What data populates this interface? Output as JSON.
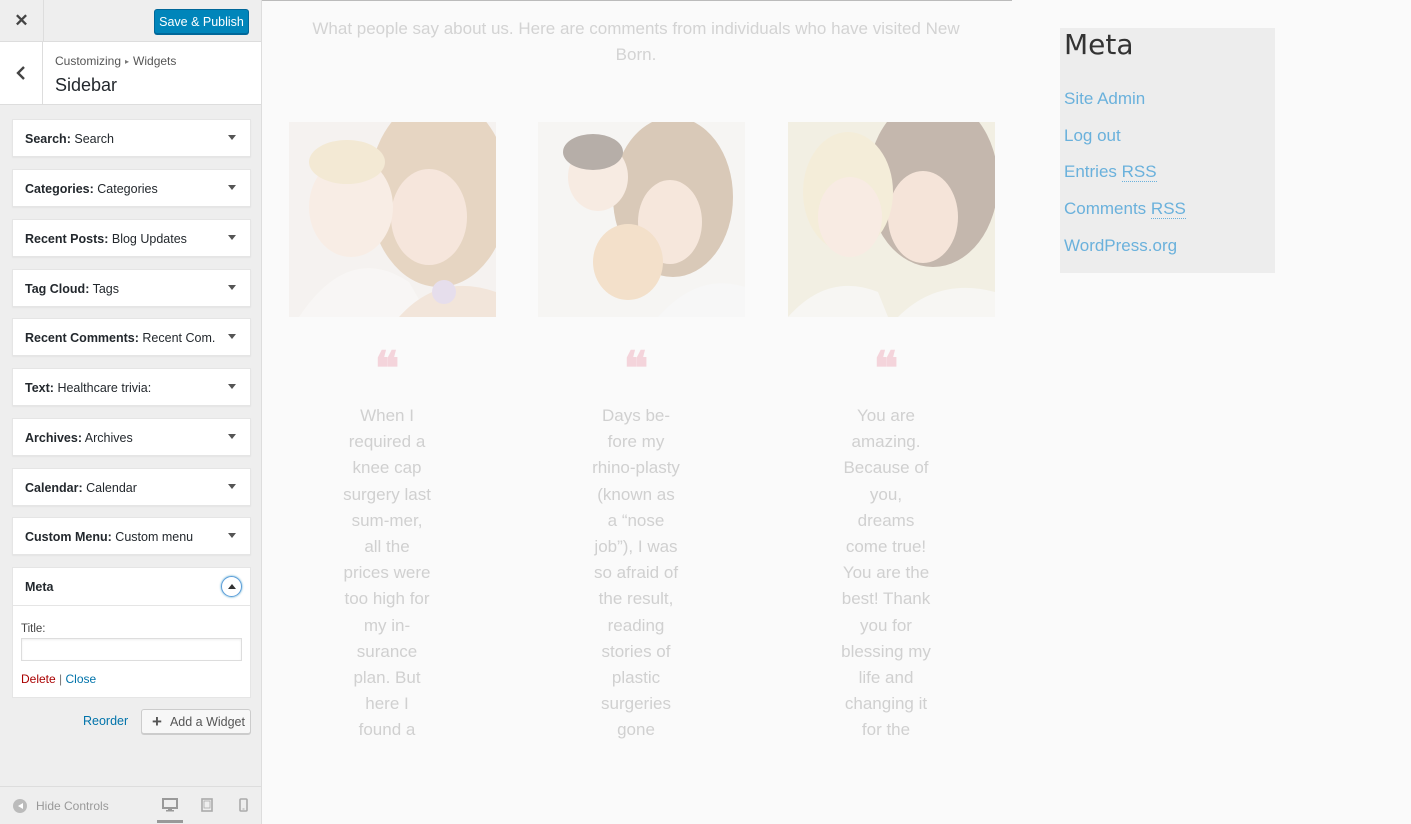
{
  "toolbar": {
    "close_icon": "close-icon",
    "publish_label": "Save & Publish"
  },
  "section": {
    "crumb_parent": "Customizing",
    "crumb_separator": "▸",
    "crumb_child": "Widgets",
    "title": "Sidebar"
  },
  "widgets": [
    {
      "type": "Search",
      "title": "Search"
    },
    {
      "type": "Categories",
      "title": "Categories"
    },
    {
      "type": "Recent Posts",
      "title": "Blog Updates"
    },
    {
      "type": "Tag Cloud",
      "title": "Tags"
    },
    {
      "type": "Recent Comments",
      "title": "Recent Com..."
    },
    {
      "type": "Text",
      "title": "Healthcare trivia:"
    },
    {
      "type": "Archives",
      "title": "Archives"
    },
    {
      "type": "Calendar",
      "title": "Calendar"
    },
    {
      "type": "Custom Menu",
      "title": "Custom menu"
    }
  ],
  "meta_widget": {
    "name": "Meta",
    "title_label": "Title:",
    "title_value": "",
    "delete_label": "Delete",
    "separator": "|",
    "close_label": "Close"
  },
  "actions": {
    "reorder_label": "Reorder",
    "add_widget_label": "Add a Widget"
  },
  "footer": {
    "hide_controls_label": "Hide Controls",
    "devices": [
      "desktop",
      "tablet",
      "mobile"
    ]
  },
  "preview": {
    "intro": "What people say about us. Here are comments from individuals who have visited New Born.",
    "quote_mark": "❝",
    "testimonials": [
      "When I required a knee cap surgery last sum-mer, all the prices were too high for my in-surance plan. But here I found a",
      "Days be-fore my rhino-plasty (known as a “nose job”), I was so afraid of the result, reading stories of plastic surgeries gone",
      "You are amazing. Because of you, dreams come true! You are the best! Thank you for blessing my life and changing it for the"
    ],
    "meta_box": {
      "heading": "Meta",
      "links": [
        "Site Admin",
        "Log out",
        "Entries ",
        "Comments ",
        "WordPress.org"
      ],
      "rss_abbr": "RSS"
    }
  },
  "colors": {
    "primary_button": "#0085ba",
    "link": "#0073aa",
    "delete": "#a00",
    "meta_link": "#6ab1dc"
  }
}
